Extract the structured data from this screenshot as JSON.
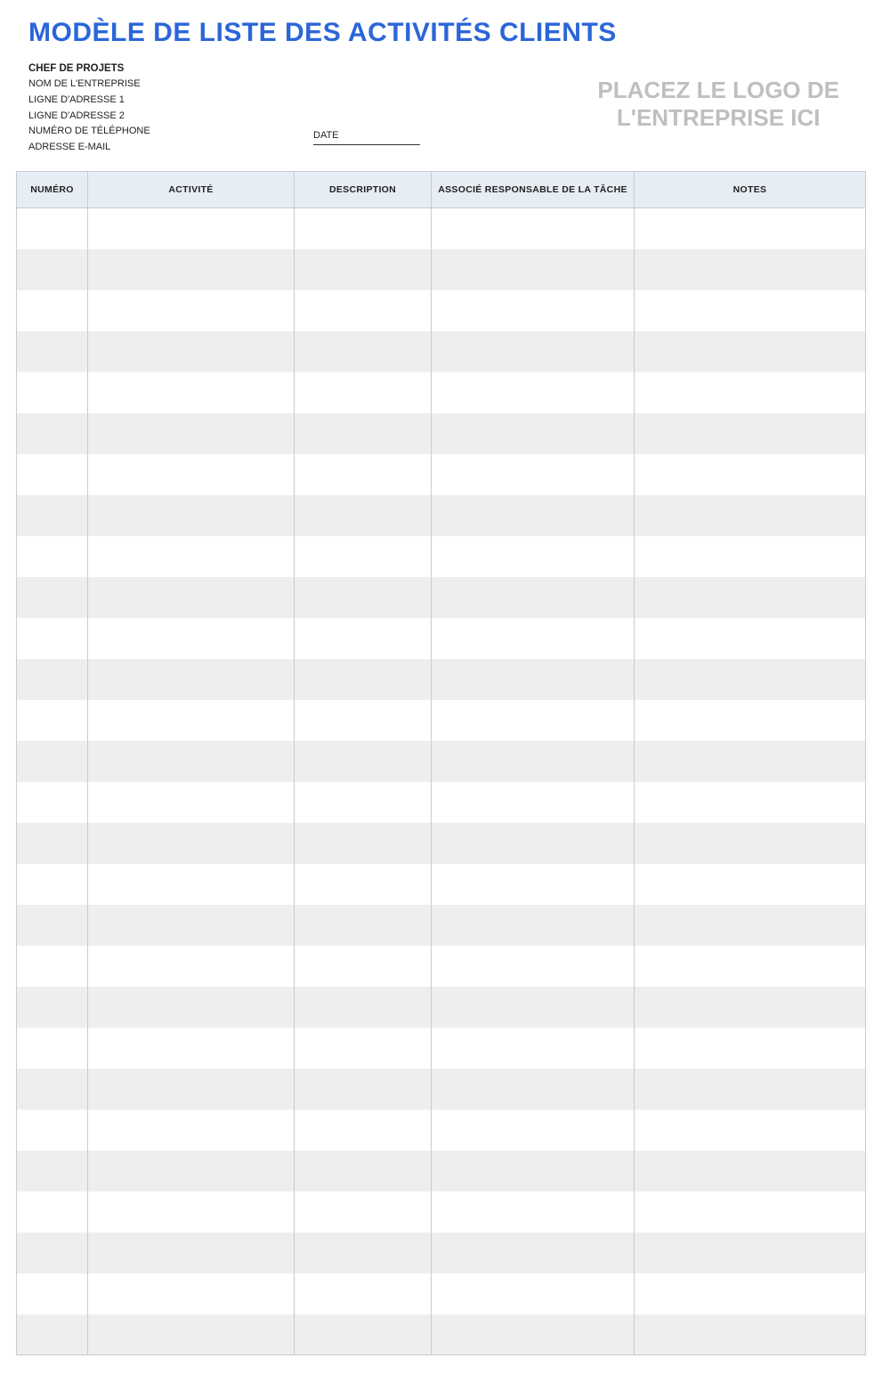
{
  "title": "MODÈLE DE LISTE DES ACTIVITÉS CLIENTS",
  "header": {
    "project_manager_label": "CHEF DE PROJETS",
    "company_name_label": "NOM DE L'ENTREPRISE",
    "address1_label": "LIGNE D'ADRESSE 1",
    "address2_label": "LIGNE D'ADRESSE 2",
    "phone_label": "NUMÉRO DE TÉLÉPHONE",
    "email_label": "ADRESSE E-MAIL",
    "date_label": "DATE",
    "logo_placeholder_line1": "PLACEZ LE LOGO DE",
    "logo_placeholder_line2": "L'ENTREPRISE ICI"
  },
  "table": {
    "columns": {
      "number": "NUMÉRO",
      "activity": "ACTIVITÉ",
      "description": "DESCRIPTION",
      "associate": "ASSOCIÉ RESPONSABLE DE LA TÂCHE",
      "notes": "NOTES"
    },
    "rows": [
      {
        "number": "",
        "activity": "",
        "description": "",
        "associate": "",
        "notes": ""
      },
      {
        "number": "",
        "activity": "",
        "description": "",
        "associate": "",
        "notes": ""
      },
      {
        "number": "",
        "activity": "",
        "description": "",
        "associate": "",
        "notes": ""
      },
      {
        "number": "",
        "activity": "",
        "description": "",
        "associate": "",
        "notes": ""
      },
      {
        "number": "",
        "activity": "",
        "description": "",
        "associate": "",
        "notes": ""
      },
      {
        "number": "",
        "activity": "",
        "description": "",
        "associate": "",
        "notes": ""
      },
      {
        "number": "",
        "activity": "",
        "description": "",
        "associate": "",
        "notes": ""
      },
      {
        "number": "",
        "activity": "",
        "description": "",
        "associate": "",
        "notes": ""
      },
      {
        "number": "",
        "activity": "",
        "description": "",
        "associate": "",
        "notes": ""
      },
      {
        "number": "",
        "activity": "",
        "description": "",
        "associate": "",
        "notes": ""
      },
      {
        "number": "",
        "activity": "",
        "description": "",
        "associate": "",
        "notes": ""
      },
      {
        "number": "",
        "activity": "",
        "description": "",
        "associate": "",
        "notes": ""
      },
      {
        "number": "",
        "activity": "",
        "description": "",
        "associate": "",
        "notes": ""
      },
      {
        "number": "",
        "activity": "",
        "description": "",
        "associate": "",
        "notes": ""
      },
      {
        "number": "",
        "activity": "",
        "description": "",
        "associate": "",
        "notes": ""
      },
      {
        "number": "",
        "activity": "",
        "description": "",
        "associate": "",
        "notes": ""
      },
      {
        "number": "",
        "activity": "",
        "description": "",
        "associate": "",
        "notes": ""
      },
      {
        "number": "",
        "activity": "",
        "description": "",
        "associate": "",
        "notes": ""
      },
      {
        "number": "",
        "activity": "",
        "description": "",
        "associate": "",
        "notes": ""
      },
      {
        "number": "",
        "activity": "",
        "description": "",
        "associate": "",
        "notes": ""
      },
      {
        "number": "",
        "activity": "",
        "description": "",
        "associate": "",
        "notes": ""
      },
      {
        "number": "",
        "activity": "",
        "description": "",
        "associate": "",
        "notes": ""
      },
      {
        "number": "",
        "activity": "",
        "description": "",
        "associate": "",
        "notes": ""
      },
      {
        "number": "",
        "activity": "",
        "description": "",
        "associate": "",
        "notes": ""
      },
      {
        "number": "",
        "activity": "",
        "description": "",
        "associate": "",
        "notes": ""
      },
      {
        "number": "",
        "activity": "",
        "description": "",
        "associate": "",
        "notes": ""
      },
      {
        "number": "",
        "activity": "",
        "description": "",
        "associate": "",
        "notes": ""
      },
      {
        "number": "",
        "activity": "",
        "description": "",
        "associate": "",
        "notes": ""
      }
    ]
  }
}
